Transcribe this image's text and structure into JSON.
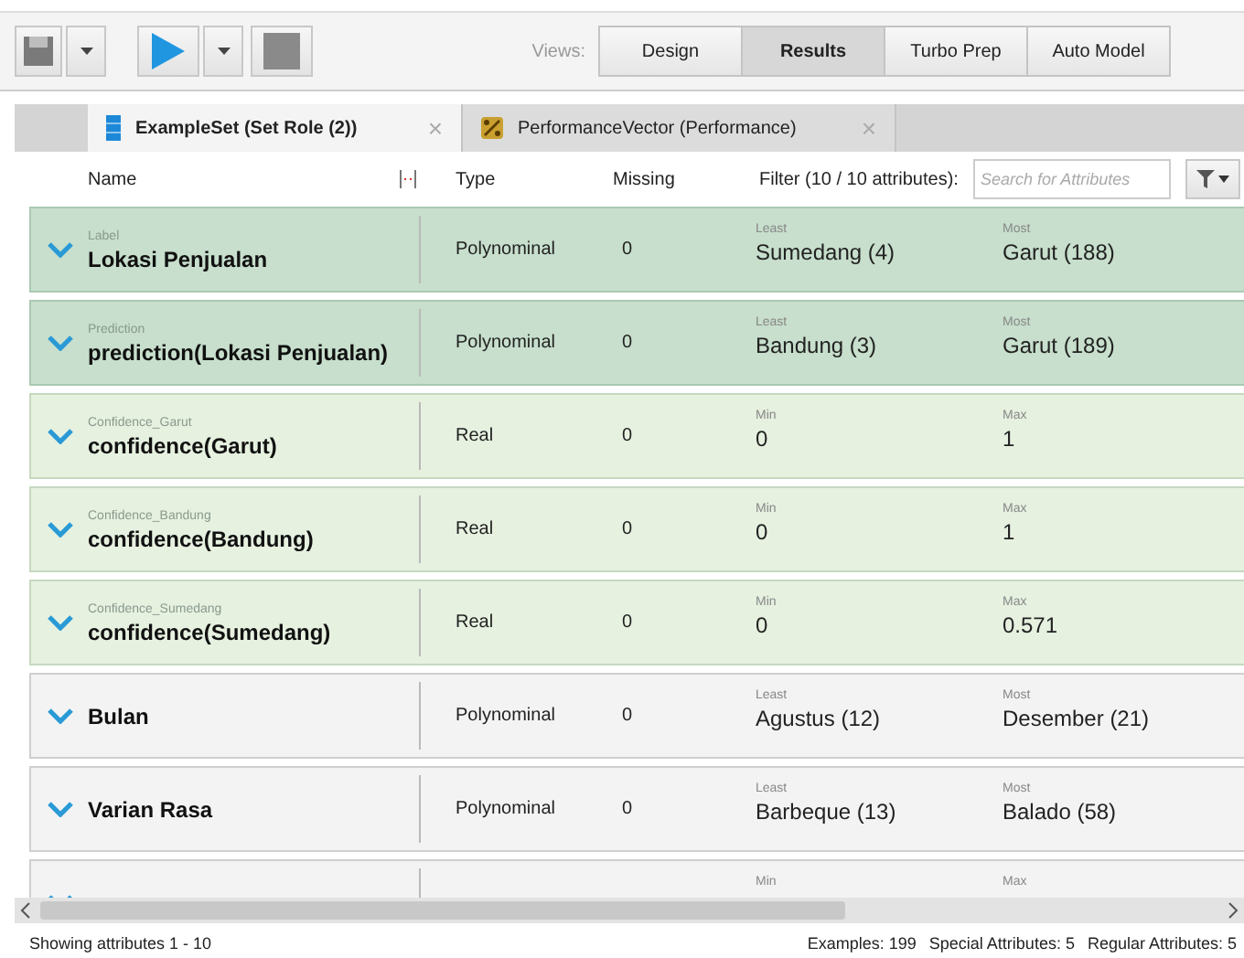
{
  "toolbar": {
    "views_label": "Views:",
    "views": [
      {
        "label": "Design",
        "selected": false
      },
      {
        "label": "Results",
        "selected": true
      },
      {
        "label": "Turbo Prep",
        "selected": false
      },
      {
        "label": "Auto Model",
        "selected": false
      }
    ]
  },
  "tabs": [
    {
      "label": "ExampleSet (Set Role (2))",
      "selected": true,
      "kind": "table",
      "close": "×"
    },
    {
      "label": "PerformanceVector (Performance)",
      "selected": false,
      "kind": "performance",
      "close": "×"
    }
  ],
  "columns": {
    "name": "Name",
    "type": "Type",
    "missing": "Missing",
    "filter": "Filter (10 / 10 attributes):",
    "search_placeholder": "Search for Attributes"
  },
  "rows": [
    {
      "kind": "special",
      "role": "Label",
      "name": "Lokasi Penjualan",
      "type": "Polynominal",
      "missing": "0",
      "stat1_label": "Least",
      "stat1": "Sumedang (4)",
      "stat2_label": "Most",
      "stat2": "Garut (188)"
    },
    {
      "kind": "special",
      "role": "Prediction",
      "name": "prediction(Lokasi Penjualan)",
      "type": "Polynominal",
      "missing": "0",
      "stat1_label": "Least",
      "stat1": "Bandung (3)",
      "stat2_label": "Most",
      "stat2": "Garut (189)"
    },
    {
      "kind": "confidence",
      "role": "Confidence_Garut",
      "name": "confidence(Garut)",
      "type": "Real",
      "missing": "0",
      "stat1_label": "Min",
      "stat1": "0",
      "stat2_label": "Max",
      "stat2": "1"
    },
    {
      "kind": "confidence",
      "role": "Confidence_Bandung",
      "name": "confidence(Bandung)",
      "type": "Real",
      "missing": "0",
      "stat1_label": "Min",
      "stat1": "0",
      "stat2_label": "Max",
      "stat2": "1"
    },
    {
      "kind": "confidence",
      "role": "Confidence_Sumedang",
      "name": "confidence(Sumedang)",
      "type": "Real",
      "missing": "0",
      "stat1_label": "Min",
      "stat1": "0",
      "stat2_label": "Max",
      "stat2": "0.571"
    },
    {
      "kind": "regular",
      "name": "Bulan",
      "type": "Polynominal",
      "missing": "0",
      "stat1_label": "Least",
      "stat1": "Agustus (12)",
      "stat2_label": "Most",
      "stat2": "Desember (21)"
    },
    {
      "kind": "regular",
      "name": "Varian Rasa",
      "type": "Polynominal",
      "missing": "0",
      "stat1_label": "Least",
      "stat1": "Barbeque (13)",
      "stat2_label": "Most",
      "stat2": "Balado (58)"
    },
    {
      "kind": "regular",
      "stat1_label": "Min",
      "stat2_label": "Max"
    }
  ],
  "status": {
    "left": "Showing attributes 1 - 10",
    "examples": "Examples: 199",
    "special": "Special Attributes: 5",
    "regular": "Regular Attributes: 5"
  }
}
